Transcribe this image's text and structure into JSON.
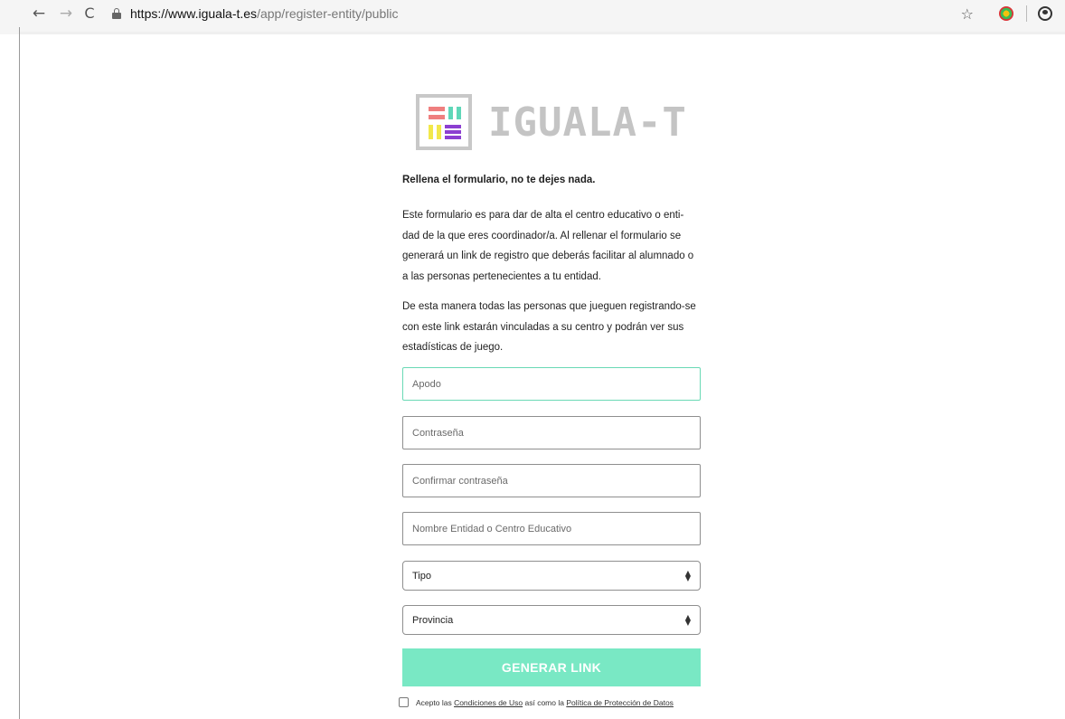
{
  "browser": {
    "back_icon": "←",
    "forward_icon": "→",
    "reload_icon": "C",
    "url_host": "https://www.iguala-t.es",
    "url_path": "/app/register-entity/public",
    "star_icon": "☆"
  },
  "logo": {
    "text": "IGUALA-T"
  },
  "intro": {
    "title": "Rellena el formulario, no te dejes nada.",
    "para1": "Este formulario es para dar de alta el centro educativo o enti- dad de la que eres coordinador/a. Al rellenar el formulario se generará un link de registro que deberás facilitar al alumnado o a las personas pertenecientes a tu entidad.",
    "para2": "De esta manera todas las personas que jueguen registrando-se con este link estarán vinculadas a su centro y podrán ver sus estadísticas de juego."
  },
  "form": {
    "apodo_placeholder": "Apodo",
    "password_placeholder": "Contraseña",
    "confirm_placeholder": "Confirmar contraseña",
    "entity_placeholder": "Nombre Entidad o Centro Educativo",
    "tipo_selected": "Tipo",
    "provincia_selected": "Provincia",
    "submit_label": "GENERAR LINK"
  },
  "terms": {
    "prefix": "Acepto las ",
    "link1": "Condiciones de Uso",
    "middle": " así como la ",
    "link2": "Política de Protección de Datos",
    "suffix": ""
  },
  "colors": {
    "accent": "#79e8c4",
    "focus_border": "#6ad9b5"
  }
}
